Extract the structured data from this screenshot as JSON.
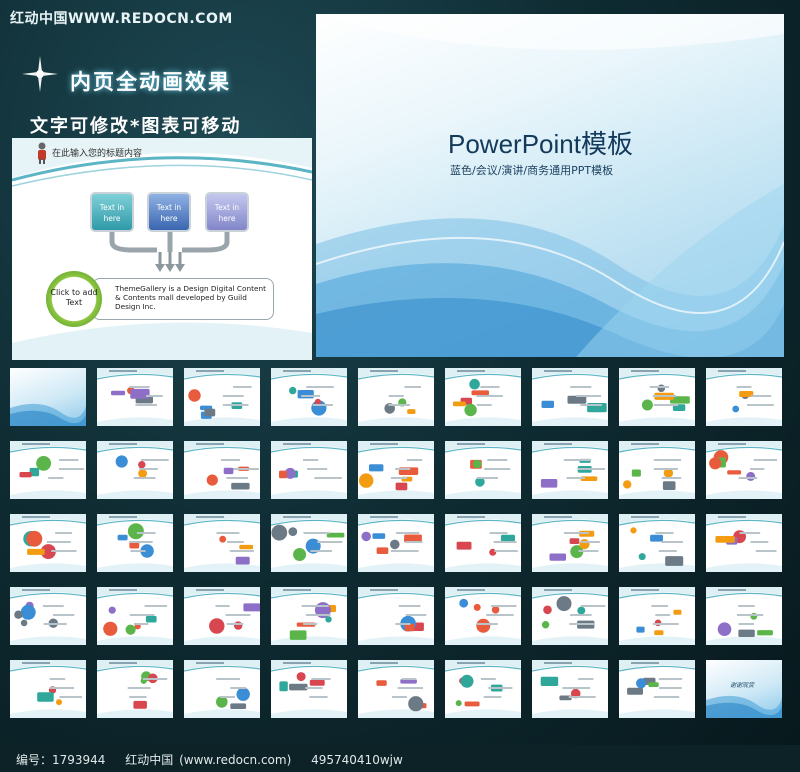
{
  "watermark": "红动中国WWW.REDOCN.COM",
  "headline1": "内页全动画效果",
  "headline2": "文字可修改*图表可移动",
  "cover": {
    "title": "PowerPoint模板",
    "subtitle": "蓝色/会议/演讲/商务通用PPT模板"
  },
  "inner_slide": {
    "title": "在此输入您的标题内容",
    "boxes": [
      "Text in here",
      "Text in here",
      "Text in here"
    ],
    "circle": "Click to add Text",
    "info": "ThemeGallery is a Design Digital Content & Contents mall developed by Guild Design Inc."
  },
  "last_thumb_label": "谢谢观赏",
  "footer": {
    "id_label": "编号：1793944",
    "site": "红动中国 (www.redocn.com)",
    "author": "495740410wjw"
  },
  "colors": {
    "background": "#0f2c33",
    "accent_teal": "#2f9aa8",
    "accent_blue": "#3b66b0",
    "accent_green": "#3d8a2a"
  }
}
